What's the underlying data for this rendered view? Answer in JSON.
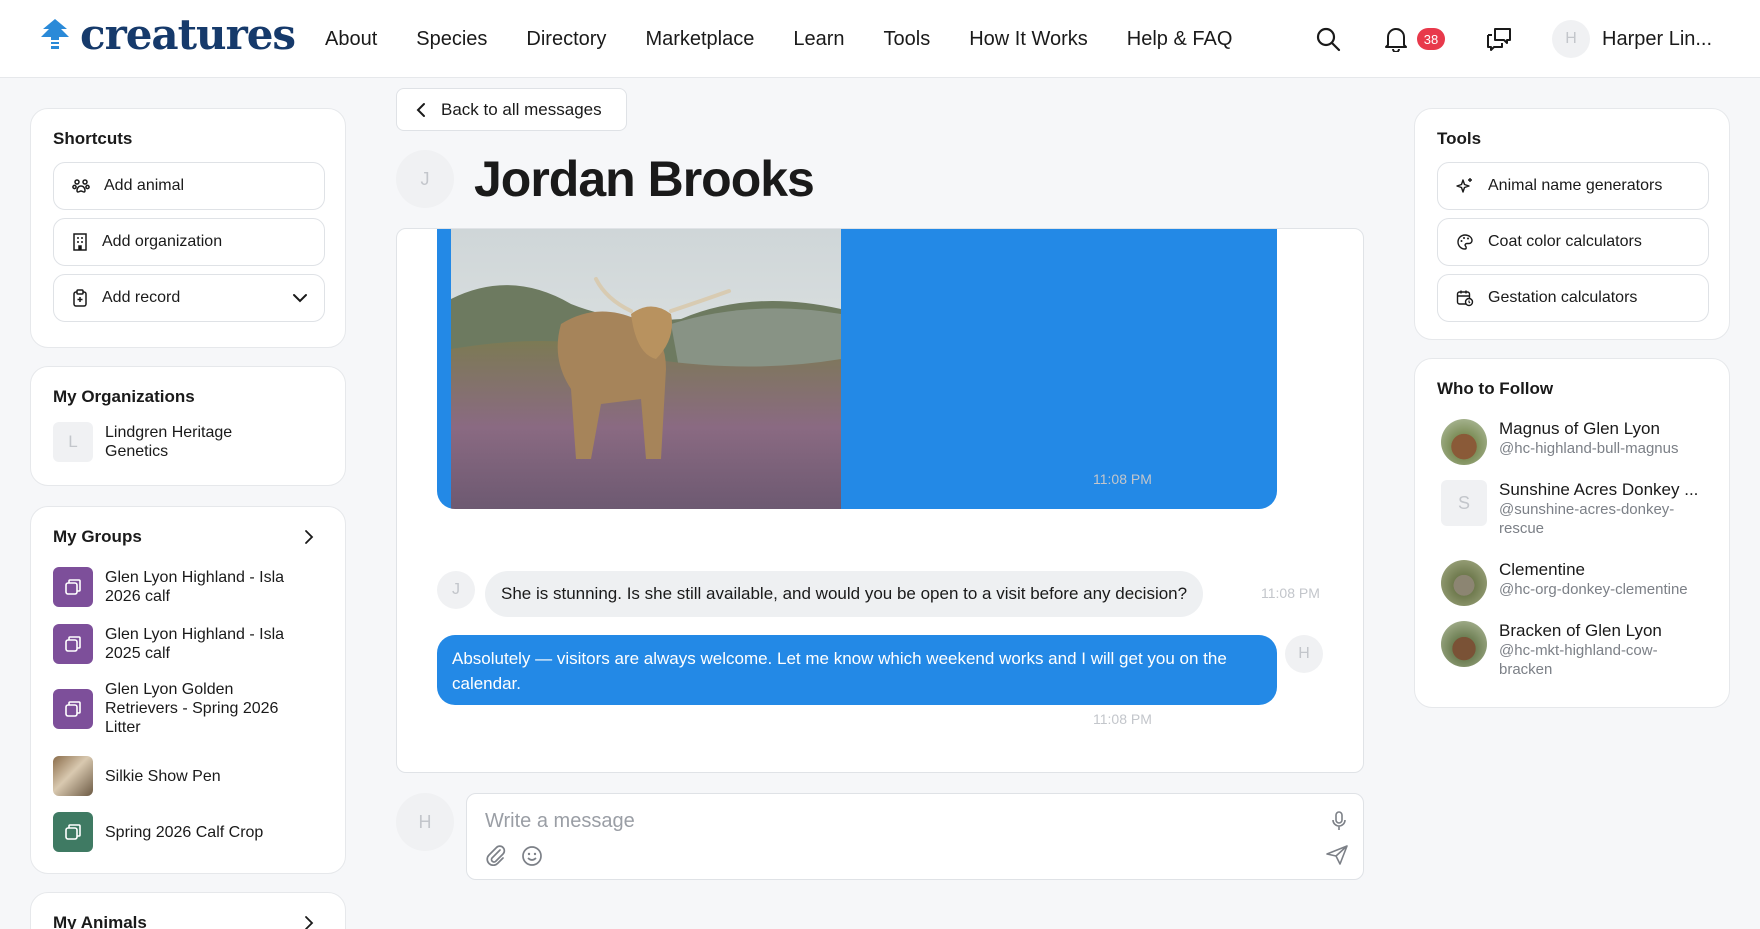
{
  "header": {
    "logo_text": "creatures",
    "nav": [
      "About",
      "Species",
      "Directory",
      "Marketplace",
      "Learn",
      "Tools",
      "How It Works",
      "Help & FAQ"
    ],
    "notification_count": "38",
    "user_initial": "H",
    "user_name": "Harper Lin..."
  },
  "shortcuts": {
    "title": "Shortcuts",
    "items": [
      "Add animal",
      "Add organization",
      "Add record"
    ]
  },
  "organizations": {
    "title": "My Organizations",
    "items": [
      {
        "initial": "L",
        "name": "Lindgren Heritage Genetics"
      }
    ]
  },
  "groups": {
    "title": "My Groups",
    "items": [
      {
        "name": "Glen Lyon Highland - Isla 2026 calf"
      },
      {
        "name": "Glen Lyon Highland - Isla 2025 calf"
      },
      {
        "name": "Glen Lyon Golden Retrievers - Spring 2026 Litter"
      },
      {
        "name": "Silkie Show Pen"
      },
      {
        "name": "Spring 2026 Calf Crop"
      }
    ]
  },
  "animals": {
    "title": "My Animals"
  },
  "chat": {
    "back_label": "Back to all messages",
    "contact_initial": "J",
    "contact_name": "Jordan Brooks",
    "messages": [
      {
        "time": "11:08 PM"
      },
      {
        "text": "She is stunning. Is she still available, and would you be open to a visit before any decision?",
        "time": "11:08 PM",
        "initial": "J"
      },
      {
        "text": "Absolutely — visitors are always welcome. Let me know which weekend works and I will get you on the calendar.",
        "time": "11:08 PM",
        "initial": "H"
      }
    ],
    "composer_initial": "H",
    "composer_placeholder": "Write a message"
  },
  "tools": {
    "title": "Tools",
    "items": [
      "Animal name generators",
      "Coat color calculators",
      "Gestation calculators"
    ]
  },
  "follow": {
    "title": "Who to Follow",
    "items": [
      {
        "name": "Magnus of Glen Lyon",
        "handle": "@hc-highland-bull-magnus"
      },
      {
        "name": "Sunshine Acres Donkey ...",
        "handle": "@sunshine-acres-donkey-rescue",
        "initial": "S"
      },
      {
        "name": "Clementine",
        "handle": "@hc-org-donkey-clementine"
      },
      {
        "name": "Bracken of Glen Lyon",
        "handle": "@hc-mkt-highland-cow-bracken"
      }
    ]
  },
  "colors": {
    "accent": "#2389e6",
    "brand": "#163a6b",
    "badge": "#e8394b",
    "group_icon": "#7d4f9a",
    "group_icon_alt": "#3f7a63"
  }
}
